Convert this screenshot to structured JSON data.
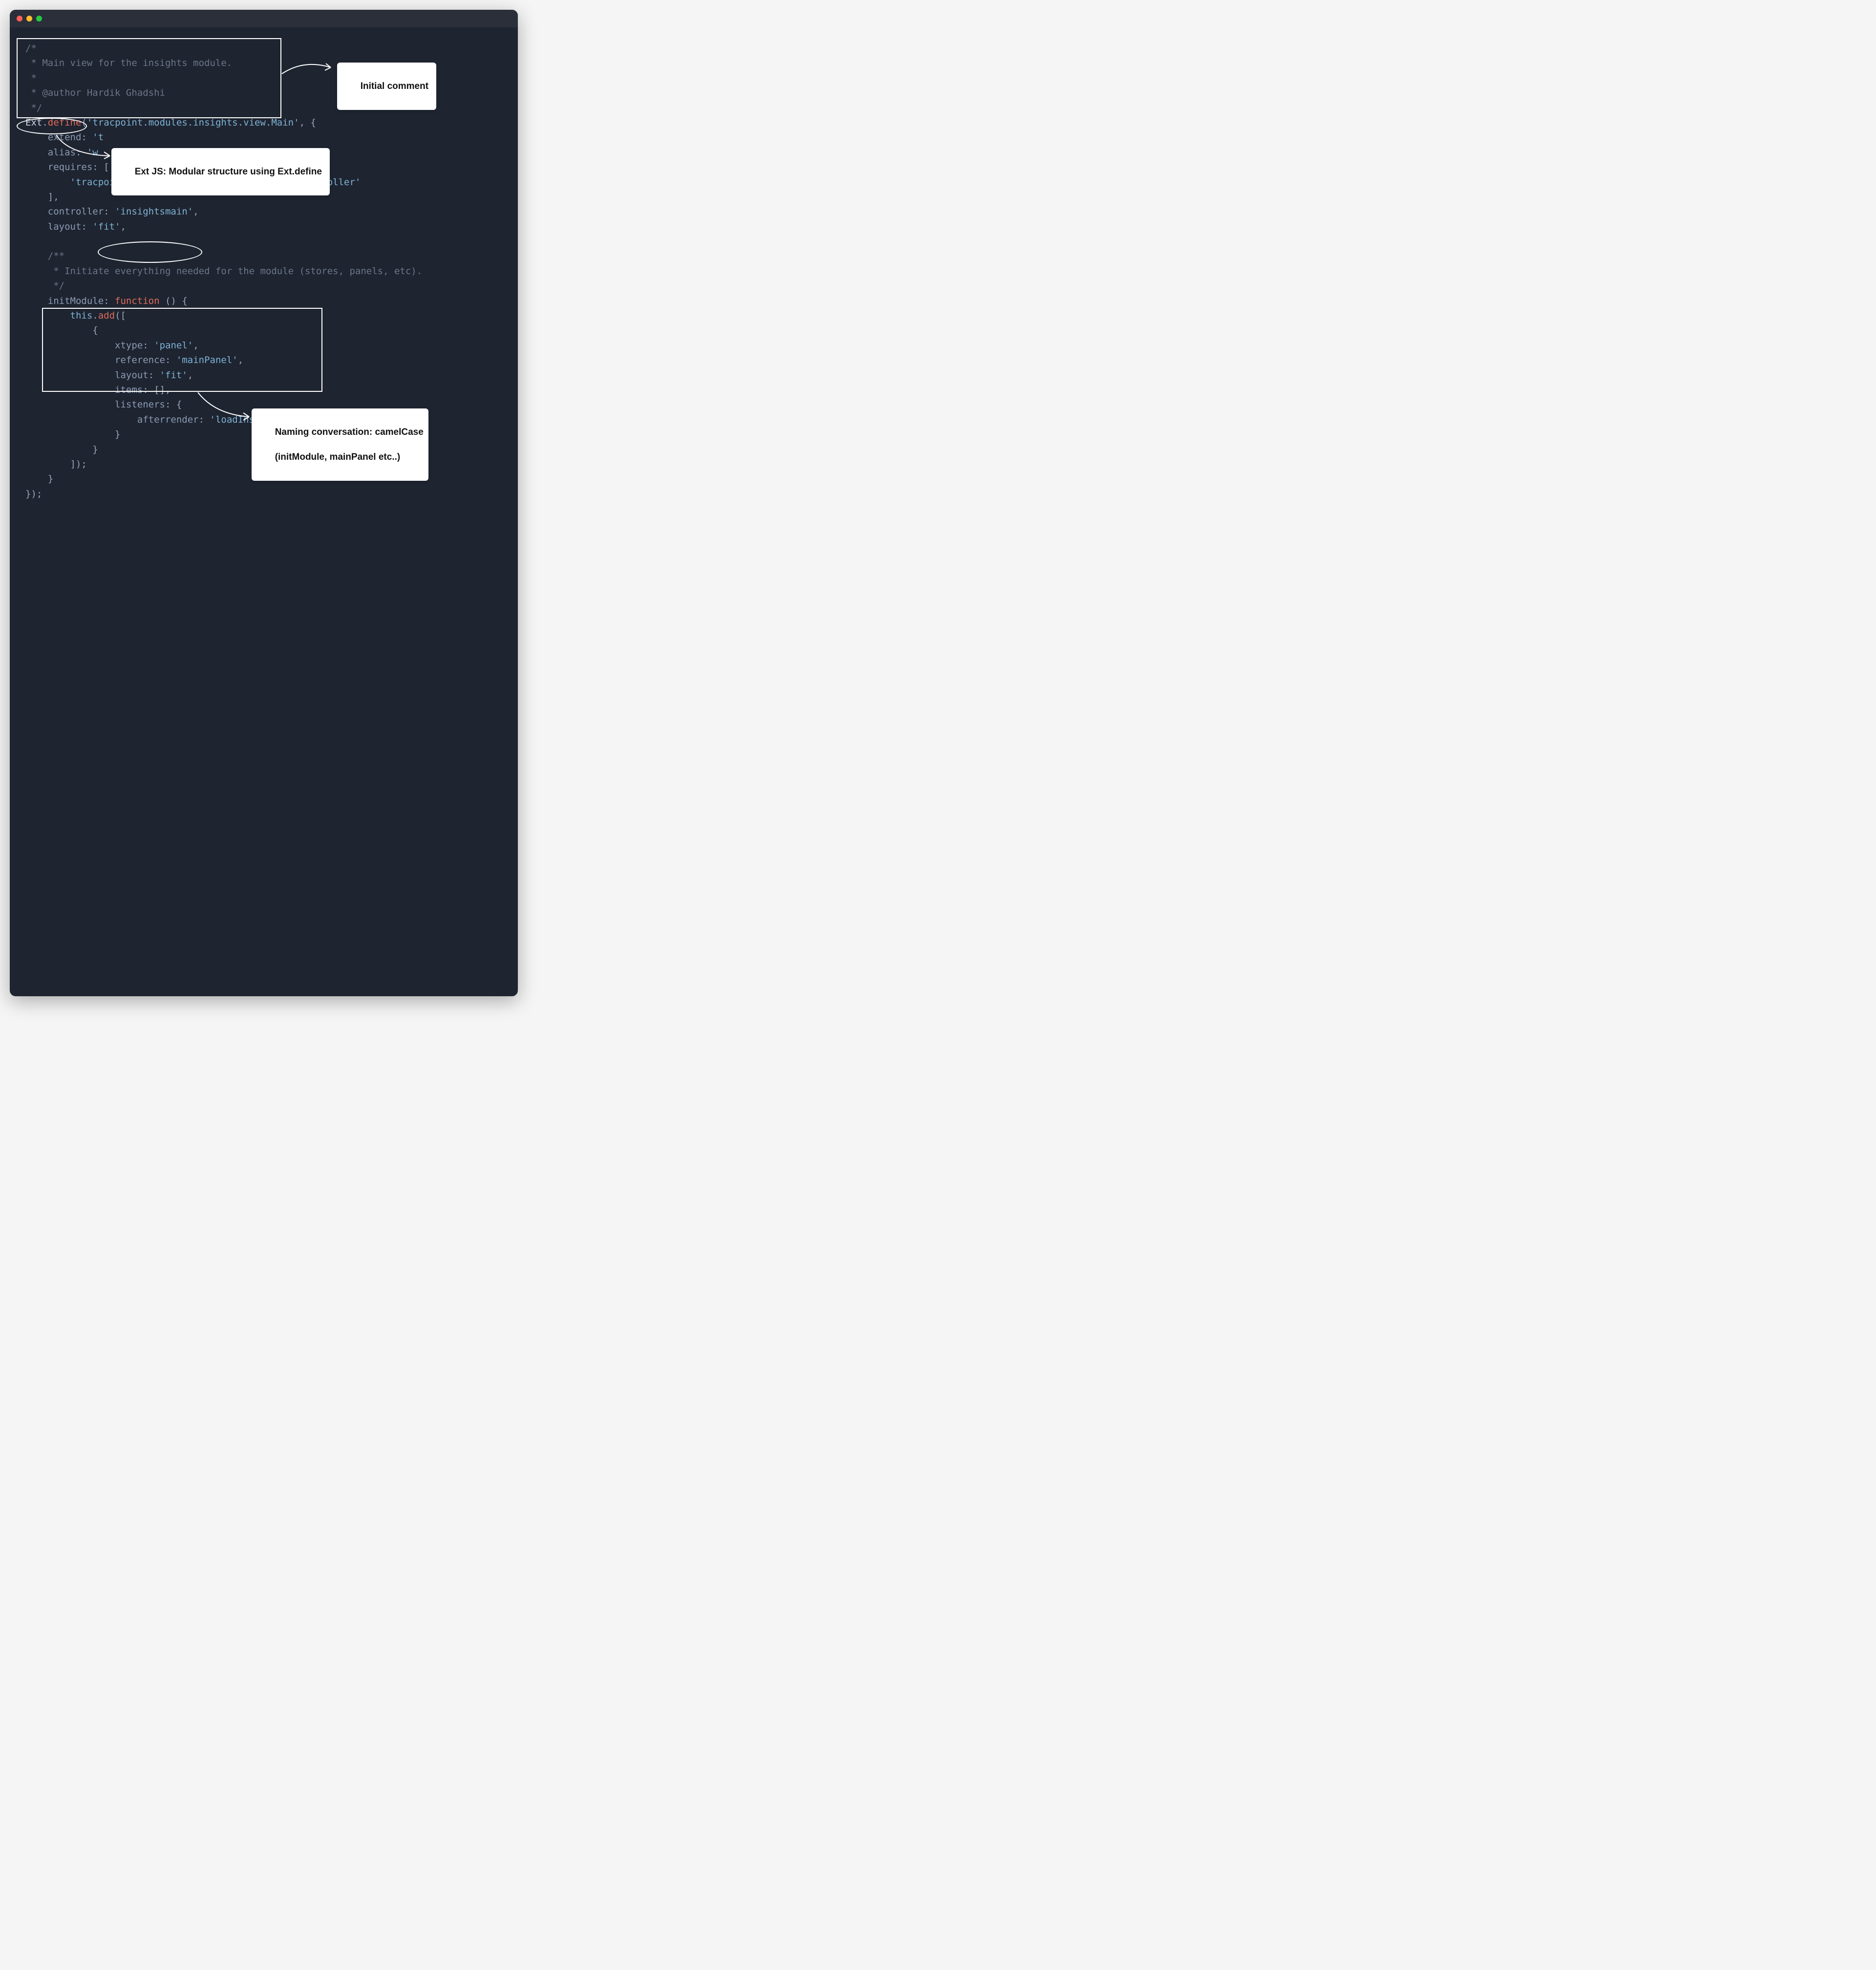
{
  "code": {
    "comment_block": [
      "/*",
      " * Main view for the insights module.",
      " *",
      " * @author Hardik Ghadshi",
      " */"
    ],
    "ext": "Ext",
    "define": "define",
    "class_name": "'tracpoint.modules.insights.view.Main'",
    "extend_key": "extend",
    "extend_val_partial": "'t",
    "alias_key": "alias",
    "alias_val_partial": "'w",
    "requires_key": "requires",
    "requires_val": "'tracpoint.modules.insights.view.MainViewController'",
    "controller_key": "controller",
    "controller_val": "'insightsmain'",
    "layout_key": "layout",
    "layout_val": "'fit'",
    "doc_block": [
      "/**",
      " * Initiate everything needed for the module (stores, panels, etc).",
      " */"
    ],
    "initModule_key": "initModule",
    "function_kw": "function",
    "this_kw": "this",
    "add_method": "add",
    "xtype_key": "xtype",
    "xtype_val": "'panel'",
    "reference_key": "reference",
    "reference_val": "'mainPanel'",
    "inner_layout_key": "layout",
    "inner_layout_val": "'fit'",
    "items_key": "items",
    "listeners_key": "listeners",
    "afterrender_key": "afterrender",
    "afterrender_val": "'loadInsights'"
  },
  "callouts": {
    "initial_comment": "Initial comment",
    "extjs_modular": "Ext JS: Modular structure using Ext.define",
    "naming_line1": "Naming conversation: camelCase",
    "naming_line2": "(initModule, mainPanel etc..)"
  }
}
